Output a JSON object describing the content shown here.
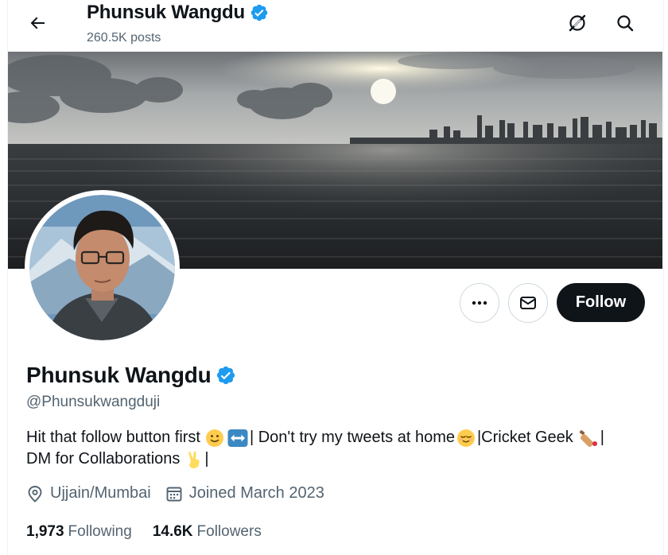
{
  "header": {
    "name": "Phunsuk Wangdu",
    "posts": "260.5K posts"
  },
  "actions": {
    "follow_label": "Follow"
  },
  "profile": {
    "name": "Phunsuk Wangdu",
    "handle": "@Phunsukwangduji",
    "bio": {
      "line1_a": "Hit that follow button first",
      "line1_b": "| Don't try my tweets at home",
      "line1_c": "|Cricket Geek",
      "line1_d": "|",
      "line2_a": "DM for Collaborations",
      "line2_b": "|"
    },
    "location": "Ujjain/Mumbai",
    "joined": "Joined March 2023",
    "following_count": "1,973",
    "following_label": "Following",
    "followers_count": "14.6K",
    "followers_label": "Followers"
  },
  "colors": {
    "verified": "#1d9bf0",
    "follow_bg": "#0f1419",
    "secondary_text": "#536471"
  }
}
